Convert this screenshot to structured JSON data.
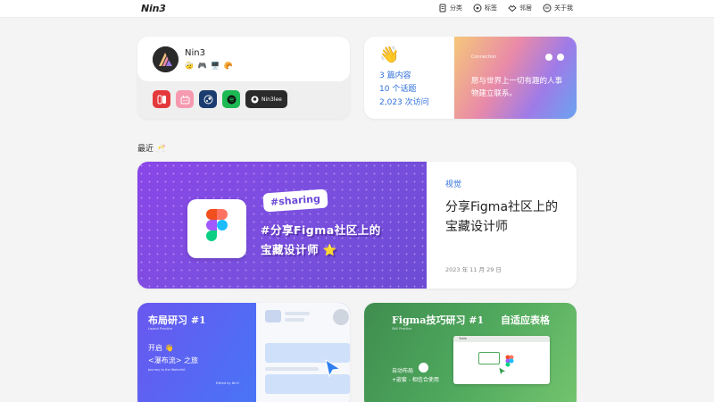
{
  "header": {
    "logo": "Nin3",
    "nav": [
      {
        "label": "分类",
        "icon": "book-icon"
      },
      {
        "label": "标签",
        "icon": "tag-circle-icon"
      },
      {
        "label": "邻居",
        "icon": "handshake-icon"
      },
      {
        "label": "关于我",
        "icon": "info-icon"
      }
    ]
  },
  "profile": {
    "name": "Nin3",
    "emojis": "🤕 🎮 🖥️ 🥐",
    "socials": [
      {
        "name": "nintendo-switch-icon",
        "color": "#e4393c"
      },
      {
        "name": "bilibili-icon",
        "color": "#f59ab0"
      },
      {
        "name": "steam-icon",
        "color": "#1b3c6e"
      },
      {
        "name": "spotify-icon",
        "color": "#1db954"
      },
      {
        "name": "github-icon",
        "color": "#2b2b2b",
        "label": "Nin3lee"
      }
    ]
  },
  "stats": {
    "wave": "👋",
    "posts": "3 篇内容",
    "topics": "10 个话题",
    "visits": "2,023 次访问",
    "connection_title": "Connection",
    "connection_text": "愿与世界上一切有趣的人事物建立联系。"
  },
  "recent": {
    "title": "最近 🥂"
  },
  "feature": {
    "tag": "#sharing",
    "headline_line1": "#分享Figma社区上的",
    "headline_line2": "宝藏设计师 ⭐",
    "category": "视觉",
    "title": "分享Figma社区上的宝藏设计师",
    "date": "2023 年 11 月 29 日"
  },
  "cards": [
    {
      "title": "布局研习 #1",
      "subtitle": "Layout Practice",
      "line1": "开启 👋",
      "line2": "<瀑布流> 之旅",
      "line3": "Journey to the Waterfall",
      "credit": "Edited by Nin3"
    },
    {
      "title": "Figma技巧研习 #1",
      "subtitle": "Skill Practice",
      "right_title": "自适应表格",
      "line1": "自动布局",
      "line2": "+嵌套 - 相信合使用",
      "window_label": "Table"
    }
  ]
}
